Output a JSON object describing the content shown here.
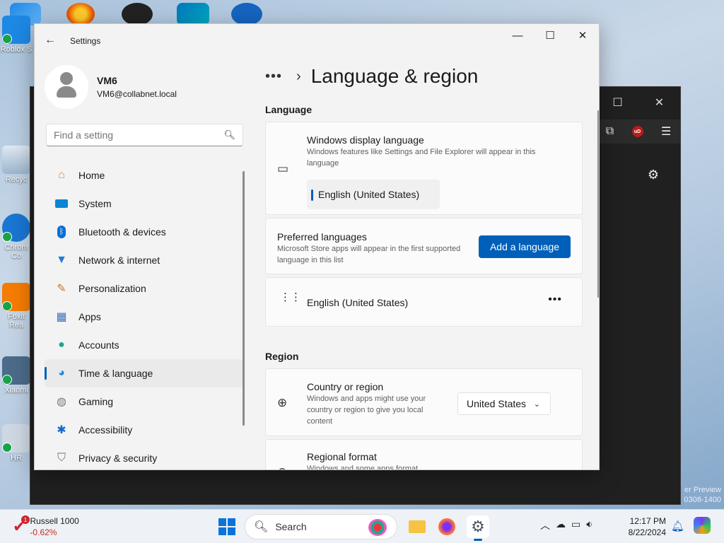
{
  "desktop": {
    "icons": [
      {
        "label": "Roblox S"
      },
      {
        "label": "Recyc"
      },
      {
        "label": "Chrom Co"
      },
      {
        "label": "Foxit Rea"
      },
      {
        "label": "Xiaomi"
      },
      {
        "label": "HR"
      }
    ]
  },
  "background_window": {
    "controls": {
      "maximize": "☐",
      "close": "✕"
    },
    "preview_text": "er Preview",
    "build_text": "0308-1400"
  },
  "settings": {
    "app_title": "Settings",
    "back_icon": "arrow-left-icon",
    "window_controls": {
      "minimize": "—",
      "maximize": "☐",
      "close": "✕"
    },
    "user": {
      "name": "VM6",
      "email": "VM6@collabnet.local"
    },
    "search": {
      "placeholder": "Find a setting"
    },
    "nav": [
      {
        "label": "Home",
        "icon": "home-icon",
        "color": "#e8833a"
      },
      {
        "label": "System",
        "icon": "system-icon",
        "color": "#0a84d4"
      },
      {
        "label": "Bluetooth & devices",
        "icon": "bluetooth-icon",
        "color": "#0a6fd6"
      },
      {
        "label": "Network & internet",
        "icon": "wifi-icon",
        "color": "#1d7cd6"
      },
      {
        "label": "Personalization",
        "icon": "brush-icon",
        "color": "#c27a3a"
      },
      {
        "label": "Apps",
        "icon": "apps-icon",
        "color": "#3b6fb8"
      },
      {
        "label": "Accounts",
        "icon": "accounts-icon",
        "color": "#1fa88a"
      },
      {
        "label": "Time & language",
        "icon": "globe-clock-icon",
        "color": "#1c8ad8",
        "active": true
      },
      {
        "label": "Gaming",
        "icon": "gamepad-icon",
        "color": "#7a7a7a"
      },
      {
        "label": "Accessibility",
        "icon": "accessibility-icon",
        "color": "#1469c8"
      },
      {
        "label": "Privacy & security",
        "icon": "shield-icon",
        "color": "#6b7280"
      }
    ],
    "breadcrumb": {
      "overflow": "•••",
      "separator": "›",
      "title": "Language & region"
    },
    "language_section": "Language",
    "display_language": {
      "title": "Windows display language",
      "desc": "Windows features like Settings and File Explorer will appear in this language",
      "value": "English (United States)"
    },
    "preferred": {
      "title": "Preferred languages",
      "desc": "Microsoft Store apps will appear in the first supported language in this list",
      "button": "Add a language"
    },
    "installed_language": {
      "label": "English (United States)",
      "more": "•••"
    },
    "region_section": "Region",
    "country": {
      "title": "Country or region",
      "desc": "Windows and apps might use your country or region to give you local content",
      "value": "United States"
    },
    "regional_format": {
      "title": "Regional format",
      "desc": "Windows and some apps format"
    }
  },
  "taskbar": {
    "ticker_name": "Russell 1000",
    "ticker_change": "-0.62%",
    "ticker_badge": "1",
    "search_label": "Search",
    "time": "12:17 PM",
    "date": "8/22/2024"
  }
}
